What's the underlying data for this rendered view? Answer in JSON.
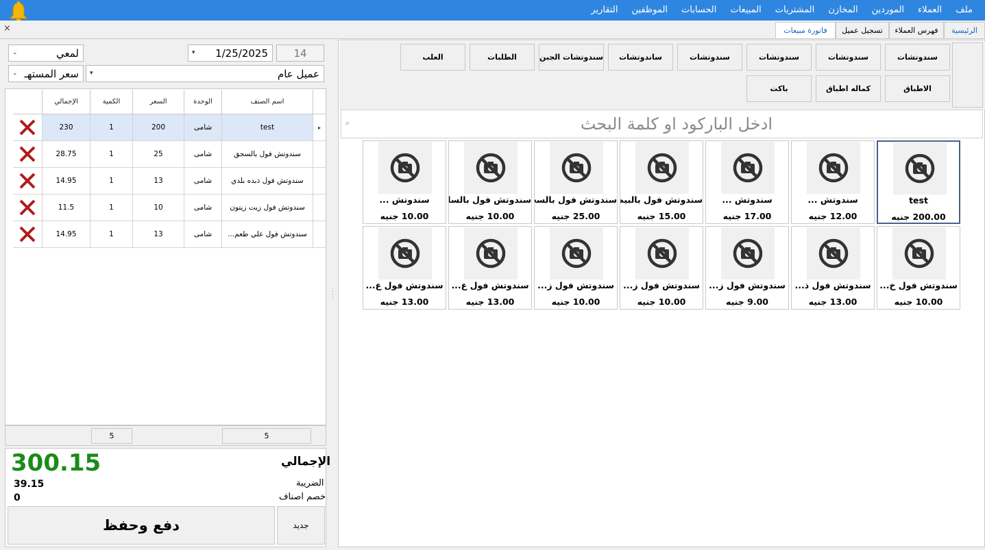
{
  "menu": [
    "ملف",
    "العملاء",
    "الموردين",
    "المخازن",
    "المشتريات",
    "المبيعات",
    "الحسابات",
    "الموظفين",
    "التقارير"
  ],
  "tabs": {
    "home": "الرئيسية",
    "customers_index": "فهرس العملاء",
    "register_customer": "تسجيل عميل",
    "sales_invoice": "فاتورة مبيعات",
    "close": "×"
  },
  "categories": {
    "c1": "سندوتشات",
    "c2": "سندوتشات",
    "c3": "سندوتشات",
    "c4": "سندوتشات",
    "c5": "ساندوتشات",
    "c6": "سندوتشات الجبن",
    "c7": "الطلبات",
    "c8": "العلب",
    "c9": "الاطباق",
    "c10": "كماله اطباق",
    "c11": "باكت"
  },
  "search": {
    "placeholder": "ادخل الباركود او كلمة البحث"
  },
  "products": [
    {
      "name": "test",
      "price": "200.00 جنيه"
    },
    {
      "name": "سندوتش ...",
      "price": "12.00 جنيه"
    },
    {
      "name": "سندوتش ...",
      "price": "17.00 جنيه"
    },
    {
      "name": "سندوتش فول بالبيض",
      "price": "15.00 جنيه"
    },
    {
      "name": "سندوتش فول بالسجق",
      "price": "25.00 جنيه"
    },
    {
      "name": "سندوتش فول بالسلطه",
      "price": "10.00 جنيه"
    },
    {
      "name": "سندوتش ...",
      "price": "10.00 جنيه"
    },
    {
      "name": "سندوتش فول خ...",
      "price": "10.00 جنيه"
    },
    {
      "name": "سندوتش فول ذ...",
      "price": "13.00 جنيه"
    },
    {
      "name": "سندوتش فول ز...",
      "price": "9.00 جنيه"
    },
    {
      "name": "سندوتش فول ز...",
      "price": "10.00 جنيه"
    },
    {
      "name": "سندوتش فول ز...",
      "price": "10.00 جنيه"
    },
    {
      "name": "سندوتش فول ع...",
      "price": "13.00 جنيه"
    },
    {
      "name": "سندوتش فول ع...",
      "price": "13.00 جنيه"
    }
  ],
  "invoice": {
    "number": "14",
    "date": "1/25/2025",
    "branch": "لمعي",
    "customer": "عميل عام",
    "price_type": "سعر المستهـ"
  },
  "grid": {
    "headers": {
      "name": "اسم الصنف",
      "unit": "الوحدة",
      "price": "السعر",
      "qty": "الكمية",
      "total": "الإجمالي"
    },
    "rows": [
      {
        "name": "test",
        "unit": "شامى",
        "price": "200",
        "qty": "1",
        "total": "230"
      },
      {
        "name": "سندوتش فول بالسجق",
        "unit": "شامى",
        "price": "25",
        "qty": "1",
        "total": "28.75"
      },
      {
        "name": "سندوتش فول ذبده بلدي",
        "unit": "شامى",
        "price": "13",
        "qty": "1",
        "total": "14.95"
      },
      {
        "name": "سندوتش فول زيت زيتون",
        "unit": "شامى",
        "price": "10",
        "qty": "1",
        "total": "11.5"
      },
      {
        "name": "سندوتش فول علي طعم...",
        "unit": "شامى",
        "price": "13",
        "qty": "1",
        "total": "14.95"
      }
    ],
    "footer": {
      "count_left": "5",
      "count_right": "5"
    },
    "row_marker": "▸"
  },
  "totals": {
    "grand_total": "300.15",
    "grand_label": "الإجمالي",
    "tax_label": "الضريبة",
    "tax_value": "39.15",
    "discount_label": "خصم اصناف",
    "discount_value": "0"
  },
  "actions": {
    "pay_save": "دفع وحفظ",
    "new": "جديد"
  },
  "colors": {
    "menubar": "#2f86e0",
    "total_green": "#198c19",
    "delete_red": "#b01c1c",
    "tab_blue": "#1565c0"
  }
}
